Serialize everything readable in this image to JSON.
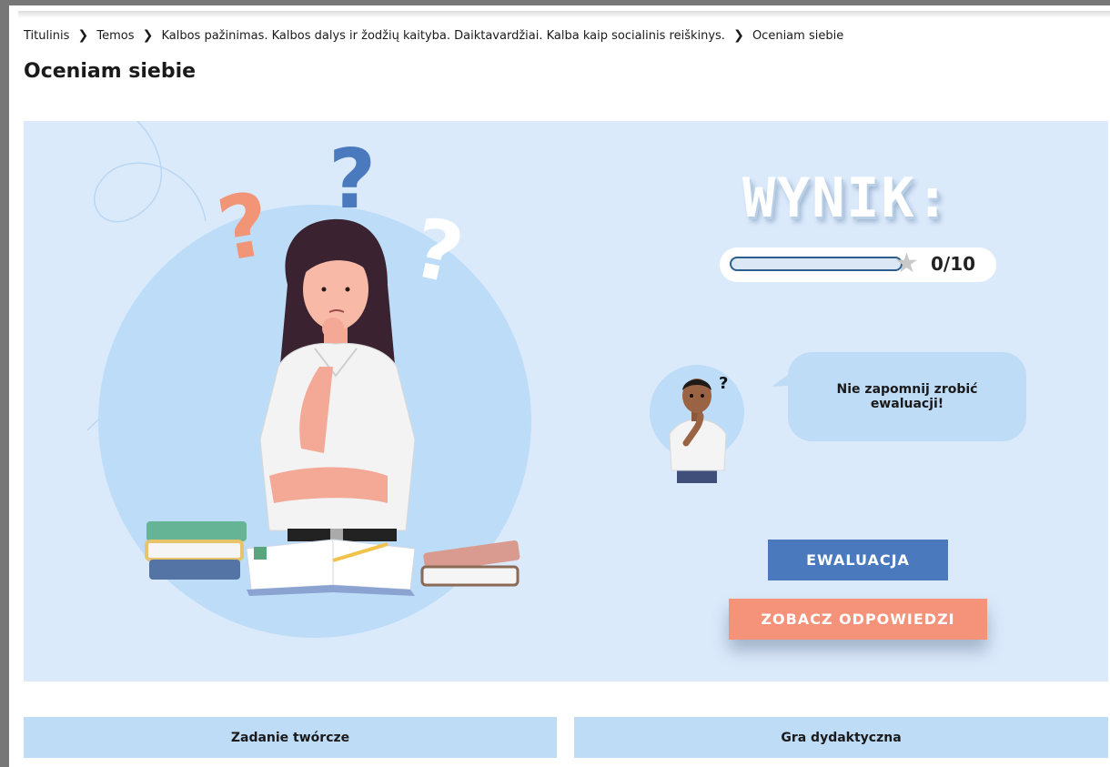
{
  "breadcrumb": {
    "items": [
      "Titulinis",
      "Temos",
      "Kalbos pažinimas. Kalbos dalys ir žodžių kaityba. Daiktavardžiai. Kalba kaip socialinis reiškinys.",
      "Oceniam siebie"
    ]
  },
  "page": {
    "title": "Oceniam siebie"
  },
  "score": {
    "title": "WYNIK:",
    "value": 0,
    "max": 10,
    "text": "0/10"
  },
  "mascot": {
    "speech": "Nie zapomnij zrobić ewaluacji!"
  },
  "buttons": {
    "evaluation": "EWALUACJA",
    "answers": "ZOBACZ ODPOWIEDZI"
  },
  "cards": [
    "Zadanie twórcze",
    "Gra dydaktyczna"
  ],
  "icons": {
    "breadcrumb_separator": "chevron-right-icon",
    "progress": "star-icon"
  },
  "colors": {
    "hero_background": "#dbeafb",
    "card_background": "#bfdcf7",
    "evaluation_button": "#4a79bd",
    "answers_button": "#f5937a"
  }
}
